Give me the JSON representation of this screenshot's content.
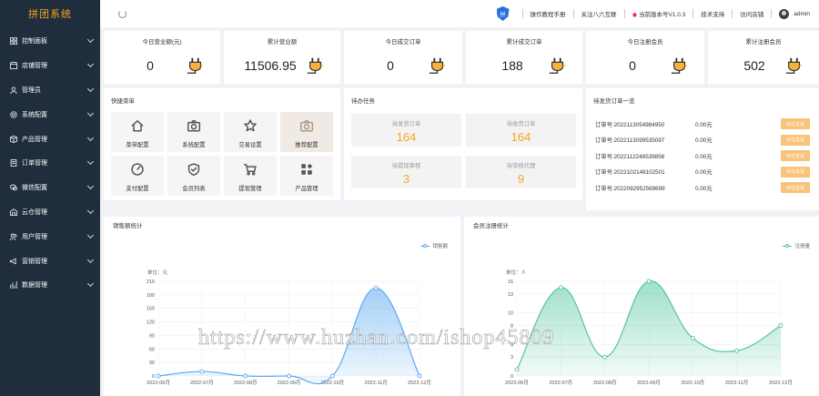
{
  "app": {
    "title": "拼团系统"
  },
  "sidebar": {
    "items": [
      {
        "label": "控制面板",
        "icon": "dashboard-icon"
      },
      {
        "label": "店铺管理",
        "icon": "shop-icon"
      },
      {
        "label": "管理员",
        "icon": "admin-icon"
      },
      {
        "label": "系统配置",
        "icon": "settings-icon"
      },
      {
        "label": "产品管理",
        "icon": "product-icon"
      },
      {
        "label": "订单管理",
        "icon": "order-icon"
      },
      {
        "label": "微信配置",
        "icon": "wechat-icon"
      },
      {
        "label": "云仓管理",
        "icon": "warehouse-icon"
      },
      {
        "label": "用户管理",
        "icon": "user-icon"
      },
      {
        "label": "营销管理",
        "icon": "marketing-icon"
      },
      {
        "label": "数据管理",
        "icon": "data-icon"
      }
    ]
  },
  "topbar": {
    "badge": "拼",
    "manual": "操作教程手册",
    "follow": "关注八六互联",
    "version": "当前版本号V1.0.3",
    "support": "技术支持",
    "website": "访问店铺",
    "user": "admin"
  },
  "stats": [
    {
      "title": "今日营业额(元)",
      "value": "0"
    },
    {
      "title": "累计营业额",
      "value": "11506.95"
    },
    {
      "title": "今日成交订单",
      "value": "0"
    },
    {
      "title": "累计成交订单",
      "value": "188"
    },
    {
      "title": "今日注册会员",
      "value": "0"
    },
    {
      "title": "累计注册会员",
      "value": "502"
    }
  ],
  "quick_menu": {
    "title": "快捷菜单",
    "items": [
      {
        "label": "菜单配置",
        "icon": "home-icon"
      },
      {
        "label": "系统配置",
        "icon": "camera-icon"
      },
      {
        "label": "交易设置",
        "icon": "star-icon"
      },
      {
        "label": "推荐配置",
        "icon": "camera-icon"
      },
      {
        "label": "支付配置",
        "icon": "gauge-icon"
      },
      {
        "label": "会员列表",
        "icon": "shield-check-icon"
      },
      {
        "label": "提现管理",
        "icon": "cart-icon"
      },
      {
        "label": "产品管理",
        "icon": "grid-icon"
      }
    ]
  },
  "tasks": {
    "title": "待办任务",
    "items": [
      {
        "label": "待发货订单",
        "value": "164"
      },
      {
        "label": "待收货订单",
        "value": "164"
      },
      {
        "label": "待提现审核",
        "value": "3"
      },
      {
        "label": "待审核代理",
        "value": "9"
      }
    ]
  },
  "pending_orders": {
    "title": "待发货订单一览",
    "button_label": "前往发货",
    "rows": [
      {
        "no": "订单号:2022113054984950",
        "amount": "0.00元"
      },
      {
        "no": "订单号:2022113099535097",
        "amount": "0.00元"
      },
      {
        "no": "订单号:2022112248539856",
        "amount": "0.00元"
      },
      {
        "no": "订单号:2022102148102501",
        "amount": "0.00元"
      },
      {
        "no": "订单号:2022092952569699",
        "amount": "0.00元"
      }
    ]
  },
  "watermark": "https://www.huzhan.com/ishop45809",
  "chart_data": [
    {
      "type": "area",
      "title": "销售额统计",
      "unit_label": "单位：元",
      "x": [
        "2022-06月",
        "2022-07月",
        "2022-08月",
        "2022-09月",
        "2022-10月",
        "2022-11月",
        "2022-12月"
      ],
      "series": [
        {
          "name": "销售额",
          "values": [
            0,
            10,
            0,
            0,
            0,
            195,
            0
          ]
        }
      ],
      "ylim": [
        0,
        210
      ],
      "yticks": [
        0,
        30,
        60,
        90,
        120,
        150,
        180,
        210
      ],
      "color": "#5aa9f0",
      "legend": "top-right",
      "grid": true
    },
    {
      "type": "area",
      "title": "会员注册统计",
      "unit_label": "单位：人",
      "x": [
        "2022-06月",
        "2022-07月",
        "2022-08月",
        "2022-09月",
        "2022-10月",
        "2022-11月",
        "2022-12月"
      ],
      "series": [
        {
          "name": "注册量",
          "values": [
            1,
            14,
            3,
            15,
            6,
            4,
            8
          ]
        }
      ],
      "ylim": [
        0,
        15
      ],
      "yticks": [
        0,
        3,
        5,
        8,
        10,
        13,
        15
      ],
      "color": "#52c5a0",
      "legend": "top-right",
      "grid": true
    }
  ]
}
